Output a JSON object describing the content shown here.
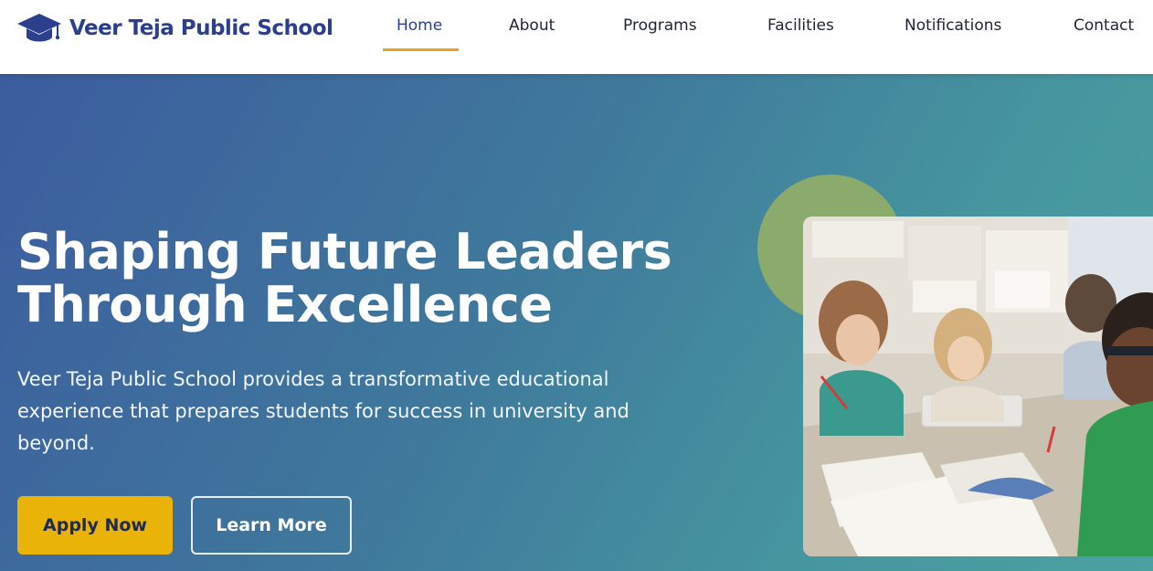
{
  "brand": {
    "name": "Veer Teja Public School",
    "icon": "graduation-cap-icon"
  },
  "nav": {
    "items": [
      {
        "label": "Home",
        "active": true
      },
      {
        "label": "About"
      },
      {
        "label": "Programs"
      },
      {
        "label": "Facilities"
      },
      {
        "label": "Notifications"
      },
      {
        "label": "Contact"
      }
    ]
  },
  "hero": {
    "headline_line1": "Shaping Future Leaders",
    "headline_line2": "Through Excellence",
    "description": "Veer Teja Public School provides a transformative educational experience that prepares students for success in university and beyond.",
    "apply_label": "Apply Now",
    "learn_label": "Learn More"
  },
  "colors": {
    "brand": "#2b3f8c",
    "accent": "#f0a020",
    "apply_button": "#eab308",
    "decor_circle": "#8aab6c"
  }
}
